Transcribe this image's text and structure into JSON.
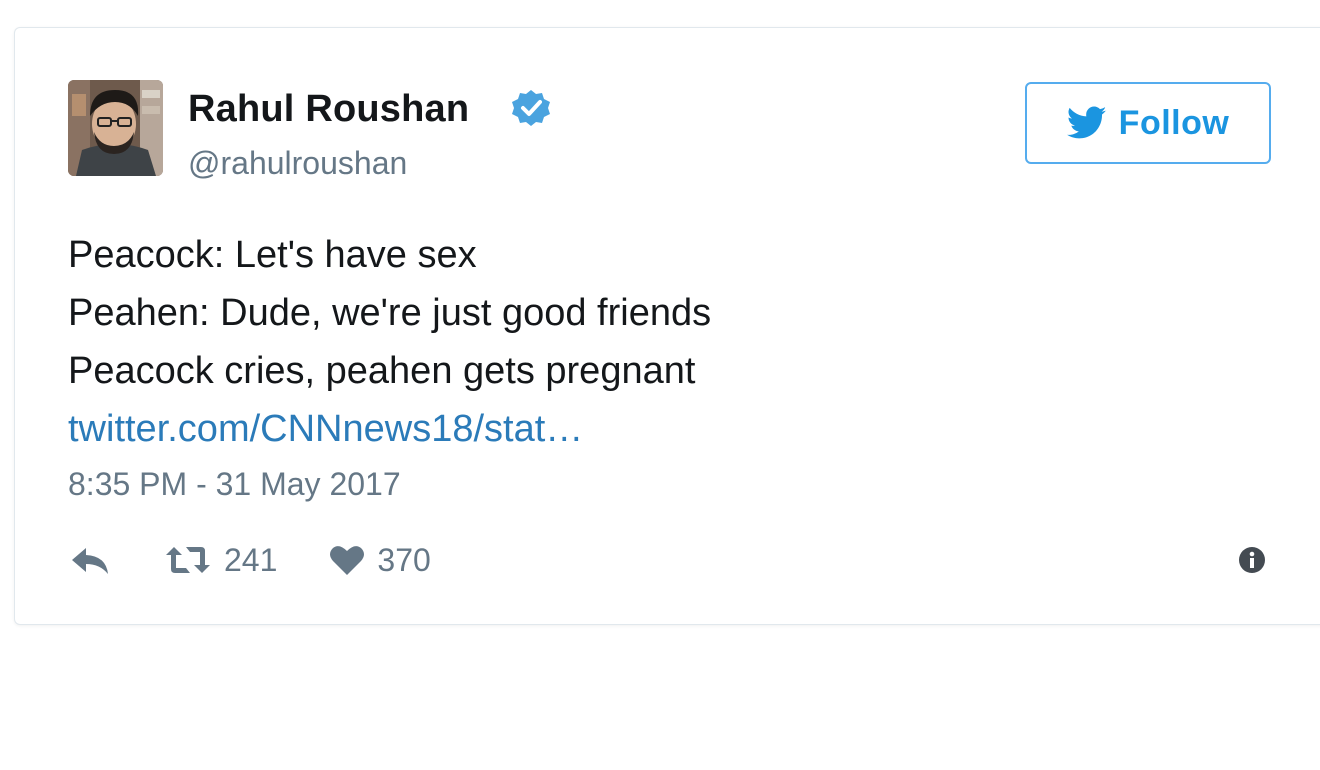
{
  "author": {
    "display_name": "Rahul Roushan",
    "handle": "@rahulroushan",
    "verified": true,
    "avatar_icon": "user-photo-avatar"
  },
  "follow_button": {
    "label": "Follow",
    "icon": "twitter-bird-icon"
  },
  "tweet": {
    "lines": [
      "Peacock: Let's have sex",
      "Peahen: Dude, we're just good friends",
      "Peacock cries, peahen gets pregnant"
    ],
    "link_text": "twitter.com/CNNnews18/stat…",
    "timestamp": "8:35 PM - 31 May 2017"
  },
  "actions": {
    "reply_icon": "reply-icon",
    "retweet_icon": "retweet-icon",
    "retweet_count": "241",
    "like_icon": "heart-icon",
    "like_count": "370",
    "info_icon": "info-icon"
  },
  "colors": {
    "twitter_blue": "#1b95e0",
    "follow_border": "#55acee",
    "verified_badge": "#4aa3df",
    "text_primary": "#14171a",
    "text_secondary": "#657786",
    "link": "#2b7bb9"
  }
}
